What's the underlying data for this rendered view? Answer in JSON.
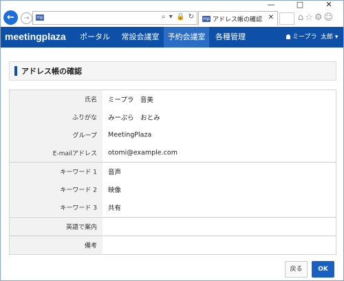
{
  "window": {
    "minimize": "—",
    "maximize": "□",
    "close": "✕"
  },
  "browser": {
    "address_favicon": "mp",
    "address_tools": "⌕ ▾ 🔒 ↻",
    "tab_favicon": "mp",
    "tab_title": "アドレス帳の確認",
    "tab_close": "✕",
    "icons": "⌂☆⚙☺"
  },
  "nav": {
    "logo": "meetingplaza",
    "items": [
      "ポータル",
      "常設会議室",
      "予約会議室",
      "各種管理"
    ],
    "active_index": 2,
    "user": "ミープラ",
    "user_menu": "太郎 ▾"
  },
  "page": {
    "title": "アドレス帳の確認"
  },
  "form": {
    "rows": [
      {
        "label": "氏名",
        "value": "ミープラ　音美"
      },
      {
        "label": "ふりがな",
        "value": "みーぷら　おとみ"
      },
      {
        "label": "グループ",
        "value": "MeetingPlaza"
      },
      {
        "label": "E-mailアドレス",
        "value": "otomi@example.com"
      },
      {
        "label": "キーワード 1",
        "value": "音声"
      },
      {
        "label": "キーワード 2",
        "value": "映像"
      },
      {
        "label": "キーワード 3",
        "value": "共有"
      },
      {
        "label": "英語で案内",
        "value": ""
      },
      {
        "label": "備考",
        "value": ""
      }
    ]
  },
  "buttons": {
    "back": "戻る",
    "ok": "OK"
  },
  "colors": {
    "brand": "#0e4fa8",
    "active_nav": "#2b6cc5",
    "ok_button": "#1a5fc2"
  }
}
